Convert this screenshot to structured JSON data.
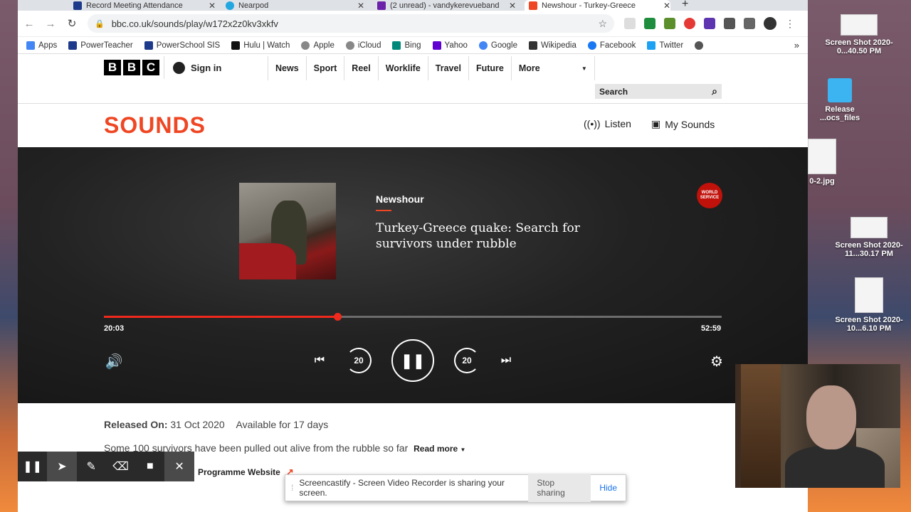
{
  "browser": {
    "tabs": [
      {
        "title": "Record Meeting Attendance",
        "color": "#1e3a8a"
      },
      {
        "title": "Nearpod",
        "color": "#22a7e0"
      },
      {
        "title": "(2 unread) - vandykerevueband",
        "color": "#6b21a8"
      },
      {
        "title": "Newshour - Turkey-Greece",
        "color": "#ef4623"
      }
    ],
    "url": "bbc.co.uk/sounds/play/w172x2z0kv3xkfv",
    "bookmarks": [
      {
        "label": "Apps",
        "color": "#4285f4"
      },
      {
        "label": "PowerTeacher",
        "color": "#1e3a8a"
      },
      {
        "label": "PowerSchool SIS",
        "color": "#1e3a8a"
      },
      {
        "label": "Hulu | Watch",
        "color": "#111111"
      },
      {
        "label": "Apple",
        "color": "#888888"
      },
      {
        "label": "iCloud",
        "color": "#888888"
      },
      {
        "label": "Bing",
        "color": "#00897b"
      },
      {
        "label": "Yahoo",
        "color": "#6001d2"
      },
      {
        "label": "Google",
        "color": "#4285f4"
      },
      {
        "label": "Wikipedia",
        "color": "#333333"
      },
      {
        "label": "Facebook",
        "color": "#1877f2"
      },
      {
        "label": "Twitter",
        "color": "#1da1f2"
      }
    ]
  },
  "bbc": {
    "logo": [
      "B",
      "B",
      "C"
    ],
    "signin": "Sign in",
    "nav": [
      "News",
      "Sport",
      "Reel",
      "Worklife",
      "Travel",
      "Future"
    ],
    "more": "More",
    "search_placeholder": "Search"
  },
  "sounds": {
    "logo": "SOUNDS",
    "listen": "Listen",
    "my_sounds": "My Sounds"
  },
  "player": {
    "programme": "Newshour",
    "episode_title": "Turkey-Greece quake: Search for survivors under rubble",
    "badge": "WORLD SERVICE",
    "current_time": "20:03",
    "duration": "52:59",
    "progress": 0.378,
    "skip_back": "20",
    "skip_forward": "20",
    "accent": "#ef2a1c"
  },
  "details": {
    "released_label": "Released On:",
    "released_date": "31 Oct 2020",
    "available": "Available for 17 days",
    "synopsis": "Some 100 survivors have been pulled out alive from the rubble so far",
    "read_more": "Read more",
    "programme_website": "Programme Website"
  },
  "screencastify": {
    "message": "Screencastify - Screen Video Recorder is sharing your screen.",
    "stop": "Stop sharing",
    "hide": "Hide"
  },
  "desktop": {
    "items": [
      "Screen Shot 2020-0...40.50 PM",
      "Release ...ocs_files",
      "0-2.jpg",
      "Screen Shot 2020-11...30.17 PM",
      "Screen Shot 2020-10...6.10 PM"
    ]
  }
}
